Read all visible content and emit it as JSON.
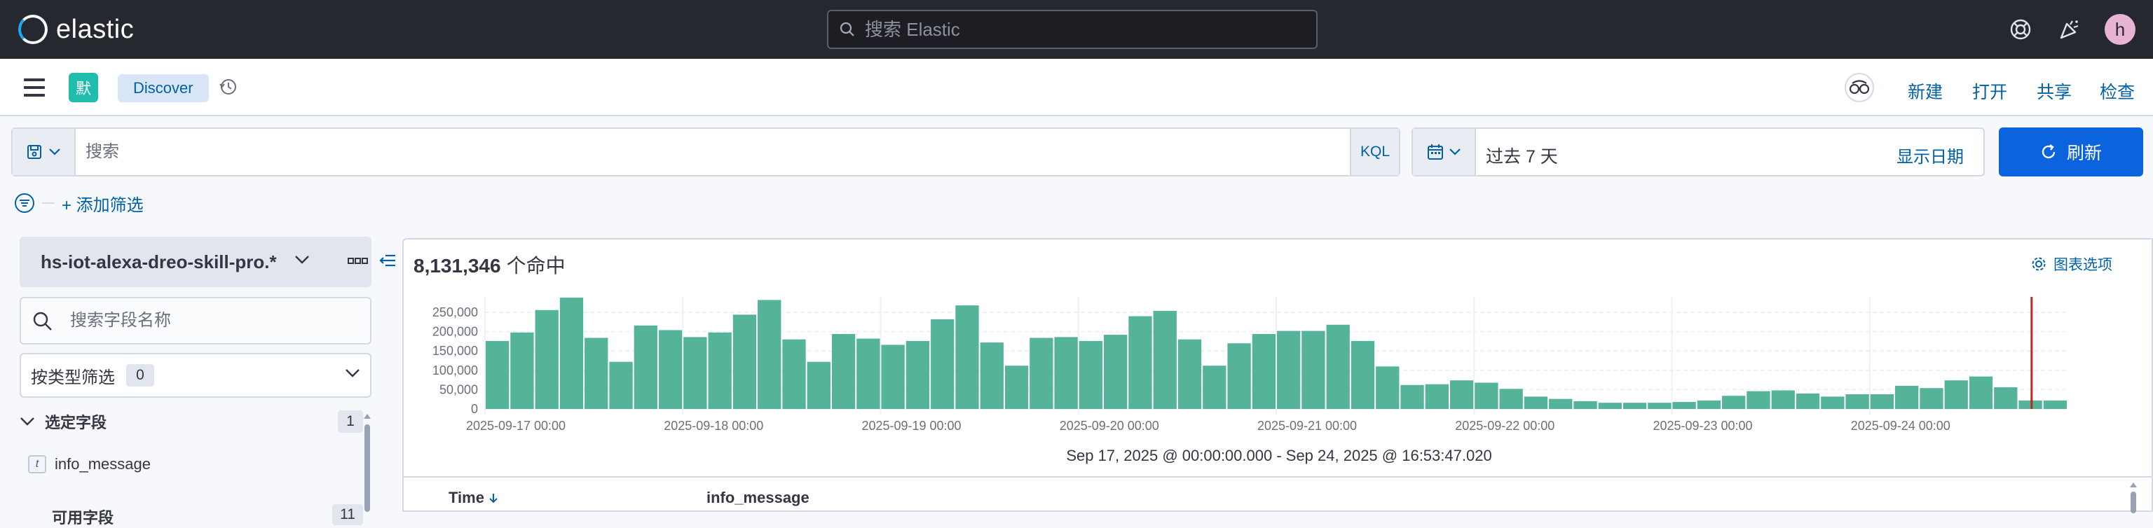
{
  "header": {
    "logo_text": "elastic",
    "search_placeholder": "搜索 Elastic",
    "avatar_initial": "h",
    "icons": [
      "help-icon",
      "newsfeed-icon"
    ]
  },
  "appbar": {
    "space_initial": "默",
    "breadcrumb": "Discover",
    "links": {
      "new": "新建",
      "open": "打开",
      "share": "共享",
      "inspect": "检查"
    }
  },
  "query": {
    "placeholder": "搜索",
    "language": "KQL",
    "time_range": "过去 7 天",
    "show_dates": "显示日期",
    "refresh": "刷新",
    "add_filter": "+ 添加筛选"
  },
  "sidebar": {
    "data_view": "hs-iot-alexa-dreo-skill-pro.*",
    "field_search_placeholder": "搜索字段名称",
    "type_filter_label": "按类型筛选",
    "type_filter_count": "0",
    "selected_fields_title": "选定字段",
    "selected_fields_count": "1",
    "selected_fields": [
      {
        "type": "t",
        "name": "info_message"
      }
    ],
    "available_fields_title": "可用字段",
    "available_fields_count": "11"
  },
  "main": {
    "hits_count": "8,131,346",
    "hits_suffix": "个命中",
    "chart_options": "图表选项",
    "range_label": "Sep 17, 2025 @ 00:00:00.000 - Sep 24, 2025 @ 16:53:47.020",
    "columns": [
      "Time",
      "info_message"
    ]
  },
  "colors": {
    "bar": "#54b399",
    "accent": "#0b64dd",
    "now_marker": "#bd271e"
  },
  "chart_data": {
    "type": "bar",
    "bucket_interval": "3h",
    "title": "",
    "xlabel": "",
    "ylabel": "",
    "ylim": [
      0,
      290000
    ],
    "y_ticks": [
      0,
      50000,
      100000,
      150000,
      200000,
      250000
    ],
    "y_tick_labels": [
      "0",
      "50,000",
      "100,000",
      "150,000",
      "200,000",
      "250,000"
    ],
    "x_tick_labels": [
      "2025-09-17 00:00",
      "2025-09-18 00:00",
      "2025-09-19 00:00",
      "2025-09-20 00:00",
      "2025-09-21 00:00",
      "2025-09-22 00:00",
      "2025-09-23 00:00",
      "2025-09-24 00:00"
    ],
    "values": [
      176000,
      198000,
      256000,
      288000,
      184000,
      122000,
      216000,
      204000,
      186000,
      198000,
      244000,
      282000,
      180000,
      122000,
      194000,
      182000,
      166000,
      176000,
      232000,
      268000,
      172000,
      112000,
      184000,
      186000,
      176000,
      192000,
      240000,
      254000,
      180000,
      112000,
      170000,
      194000,
      202000,
      202000,
      218000,
      176000,
      110000,
      62000,
      64000,
      74000,
      68000,
      52000,
      32000,
      26000,
      20000,
      16000,
      16000,
      16000,
      18000,
      22000,
      34000,
      46000,
      48000,
      40000,
      32000,
      38000,
      38000,
      60000,
      54000,
      74000,
      84000,
      56000,
      22000,
      22000
    ]
  }
}
